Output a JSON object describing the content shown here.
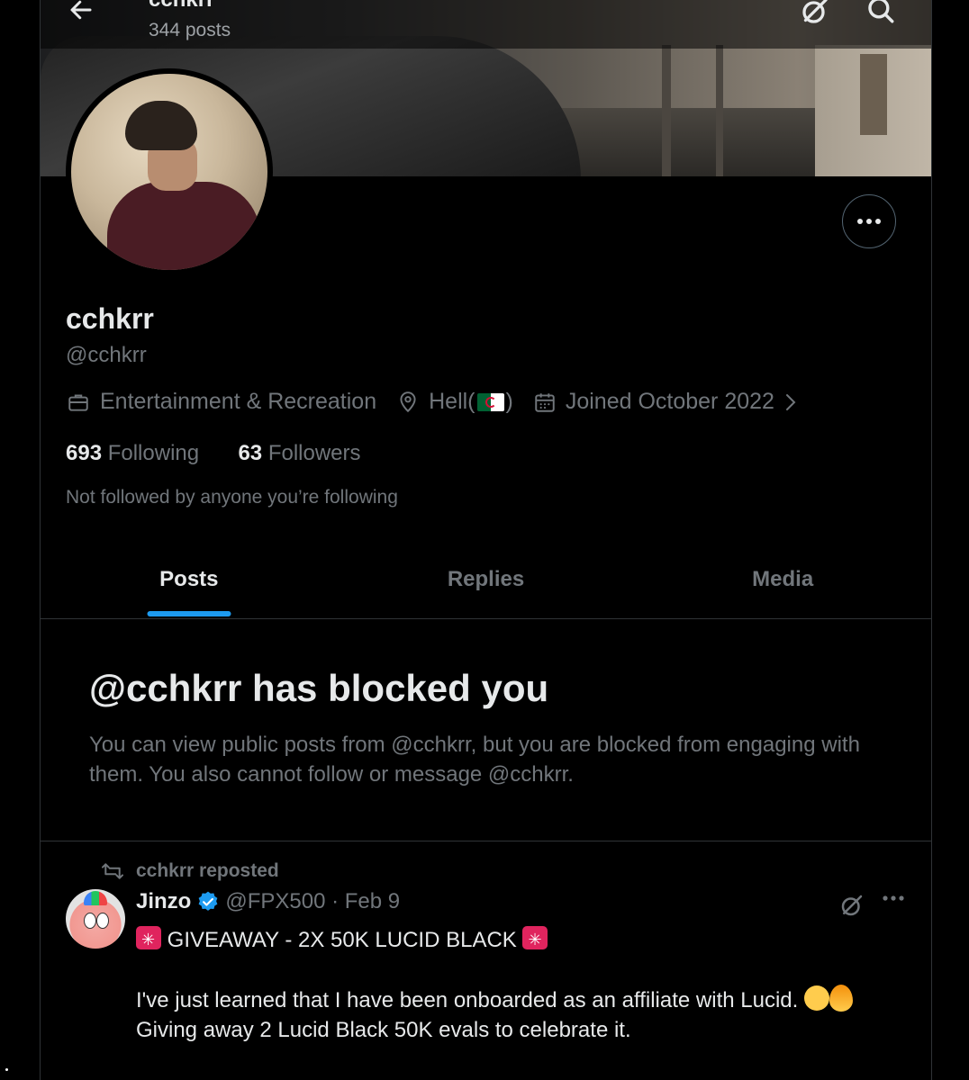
{
  "header": {
    "title": "cchkrr",
    "post_count": "344 posts"
  },
  "profile": {
    "display_name": "cchkrr",
    "handle": "@cchkrr",
    "category": "Entertainment & Recreation",
    "location_prefix": "Hell(",
    "location_suffix": ")",
    "joined": "Joined October 2022",
    "following_count": "693",
    "following_label": "Following",
    "followers_count": "63",
    "followers_label": "Followers",
    "not_followed_text": "Not followed by anyone you’re following"
  },
  "tabs": [
    {
      "label": "Posts",
      "active": true
    },
    {
      "label": "Replies",
      "active": false
    },
    {
      "label": "Media",
      "active": false
    }
  ],
  "blocked": {
    "title": "@cchkrr has blocked you",
    "message": "You can view public posts from @cchkrr, but you are blocked from engaging with them. You also cannot follow or message @cchkrr."
  },
  "post": {
    "repost_label": "cchkrr reposted",
    "author_name": "Jinzo",
    "author_handle_date": "@FPX500 · Feb 9",
    "line1": " GIVEAWAY - 2X 50K LUCID BLACK ",
    "line2a": "I've just learned that I have been onboarded as an affiliate with Lucid. ",
    "line2b": "Giving away 2 Lucid Black 50K evals to celebrate it."
  },
  "colors": {
    "accent": "#1d9bf0",
    "background": "#000000",
    "muted_text": "#71767b",
    "primary_text": "#e7e9ea",
    "border": "#2f3336"
  },
  "icons": [
    "back-arrow-icon",
    "grok-icon",
    "search-icon",
    "more-icon",
    "briefcase-icon",
    "location-pin-icon",
    "calendar-icon",
    "chevron-right-icon",
    "repost-icon",
    "verified-badge-icon"
  ]
}
